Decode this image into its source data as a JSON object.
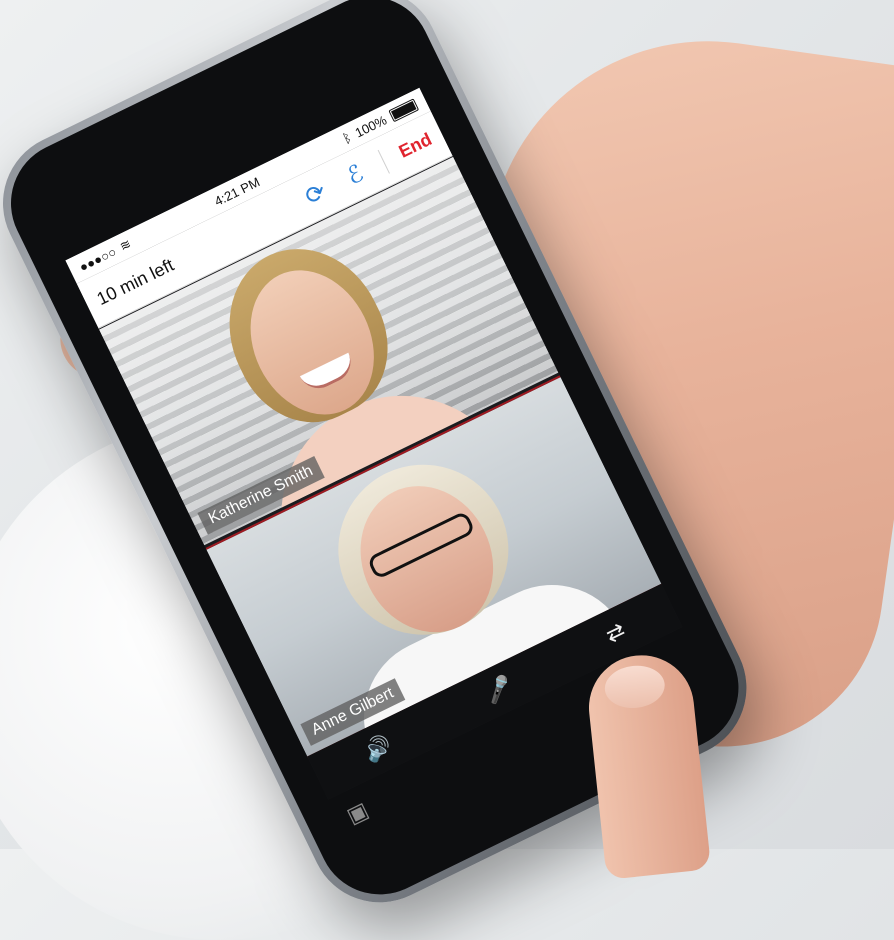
{
  "status_bar": {
    "signal": "●●●○○",
    "wifi": "wifi-icon",
    "time": "4:21 PM",
    "bluetooth": "bluetooth-icon",
    "battery_percent": "100%"
  },
  "nav_bar": {
    "time_left": "10 min left",
    "refresh_icon": "refresh-icon",
    "participants_icon": "add-participant-icon",
    "end_label": "End"
  },
  "videos": [
    {
      "name": "Katherine Smith"
    },
    {
      "name": "Anne Gilbert"
    }
  ],
  "toolbar": {
    "speaker_icon": "speaker-icon",
    "mic_icon": "microphone-icon",
    "camera_switch_icon": "camera-switch-icon",
    "gallery_icon": "gallery-icon"
  },
  "colors": {
    "accent": "#2b7fd6",
    "end": "#e0242e",
    "divider": "#9e1b22"
  }
}
